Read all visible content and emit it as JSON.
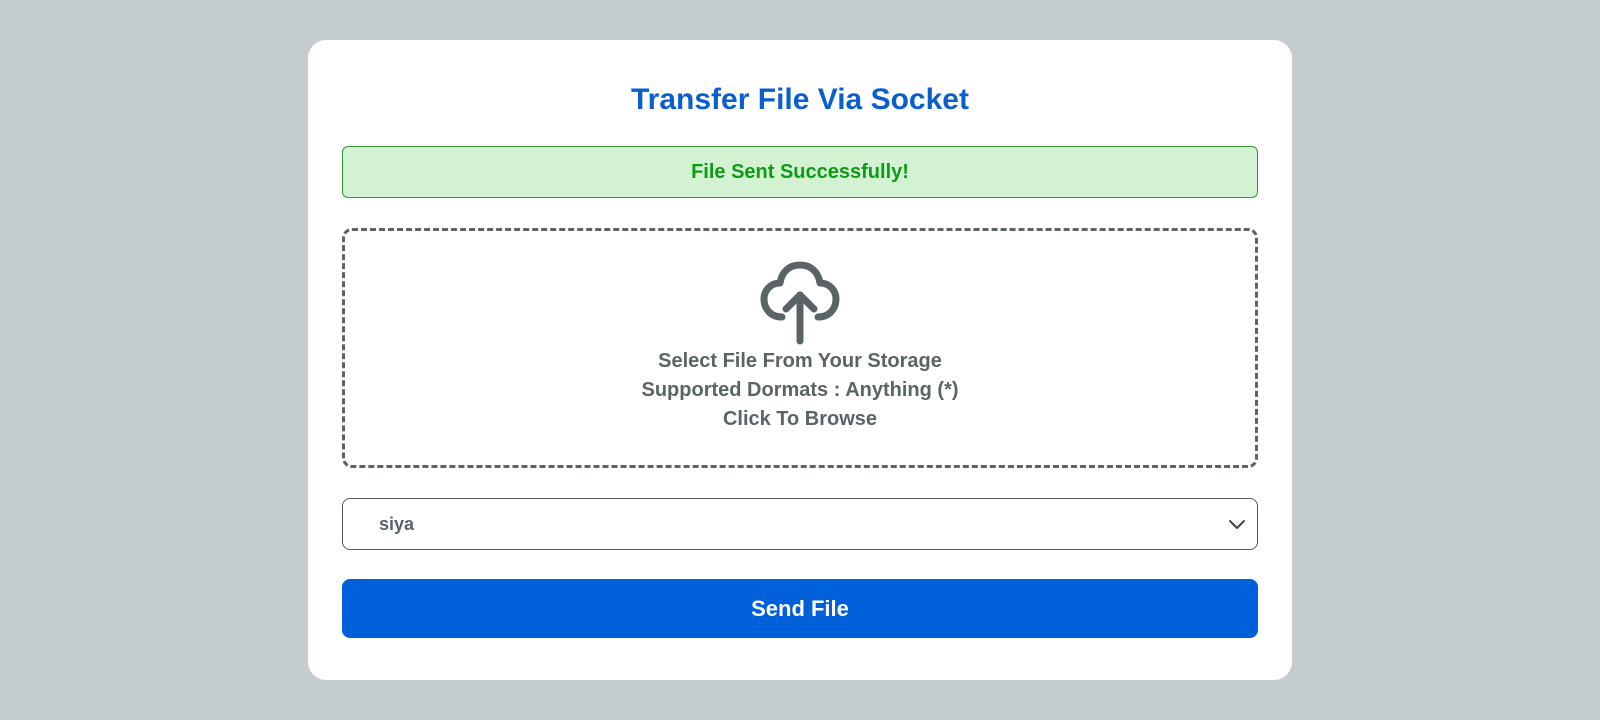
{
  "header": {
    "title": "Transfer File Via Socket"
  },
  "alert": {
    "message": "File Sent Successfully!",
    "status": "success",
    "text_color": "#0f9a16",
    "background_color": "#d3f2d2"
  },
  "dropzone": {
    "icon": "cloud-upload-icon",
    "line1": "Select File From Your Storage",
    "line2": "Supported Dormats : Anything (*)",
    "line3": "Click To Browse"
  },
  "recipient_select": {
    "selected_value": "siya",
    "icon": "chevron-down-icon"
  },
  "actions": {
    "send_label": "Send File",
    "button_color": "#0060d9"
  },
  "colors": {
    "page_background": "#c5cccd",
    "title_color": "#0a5fcc",
    "muted_text": "#5a6466"
  }
}
